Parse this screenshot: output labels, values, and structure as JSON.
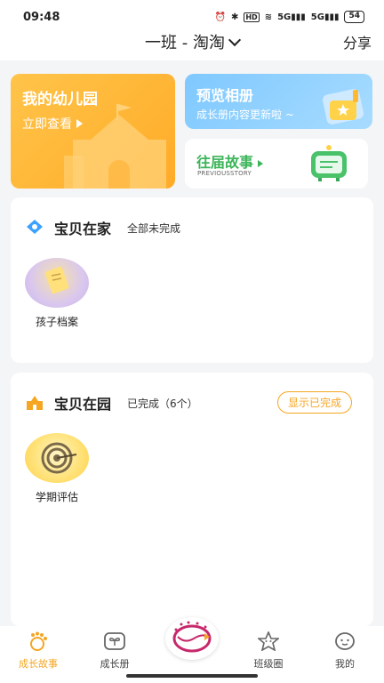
{
  "status": {
    "time": "09:48",
    "battery": "54",
    "network1": "5G",
    "network2": "5G"
  },
  "header": {
    "title": "一班 - 淘淘",
    "share": "分享"
  },
  "kindergarten": {
    "title": "我的幼儿园",
    "action": "立即查看"
  },
  "album": {
    "title": "预览相册",
    "subtitle": "成长册内容更新啦 ~"
  },
  "story": {
    "title": "往届故事",
    "subtitle": "PREVIOUSSTORY"
  },
  "home": {
    "title": "宝贝在家",
    "status": "全部未完成",
    "items": [
      {
        "label": "孩子档案"
      }
    ]
  },
  "school": {
    "title": "宝贝在园",
    "status": "已完成（6个）",
    "button": "显示已完成",
    "items": [
      {
        "label": "学期评估"
      }
    ]
  },
  "tabs": [
    {
      "label": "成长故事",
      "icon": "footprint-icon",
      "active": true
    },
    {
      "label": "成长册",
      "icon": "sprout-icon",
      "active": false
    },
    {
      "label": "班级圈",
      "icon": "star-face-icon",
      "active": false
    },
    {
      "label": "我的",
      "icon": "smile-icon",
      "active": false
    }
  ],
  "colors": {
    "accent": "#f5a623",
    "green": "#3cb55a",
    "blue": "#7ec8ff"
  }
}
